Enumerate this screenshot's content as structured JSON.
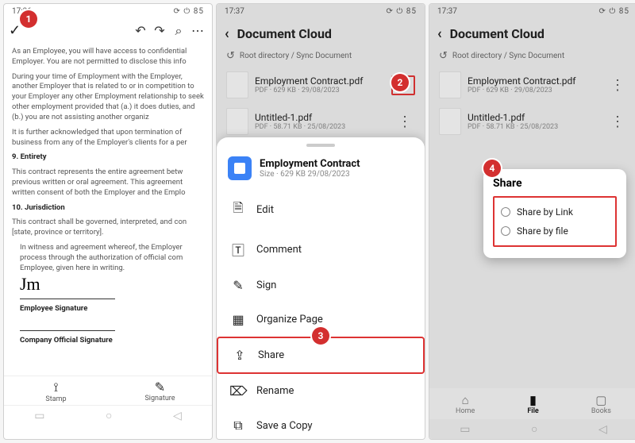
{
  "status": {
    "time_p1": "17:36",
    "time_p2": "17:37",
    "time_p3": "17:37",
    "battery": "85"
  },
  "markers": {
    "m1": "1",
    "m2": "2",
    "m3": "3",
    "m4": "4"
  },
  "p1": {
    "body": {
      "l1": "As an Employee, you will have access to confidential",
      "l2": "Employer. You are not permitted to disclose this info",
      "p2": "During your time of Employment with the Employer, another Employer that is related to or in competition to your Employer any other Employment relationship to seek other employment provided that (a.) it does duties, and (b.) you are not assisting another organiz",
      "p3": "It is further acknowledged that upon termination of business from any of the Employer's clients for a per",
      "h9": "9.   Entirety",
      "p4": "This contract represents the entire agreement betw previous written or oral agreement. This agreement written consent of both the Employer and the Emplo",
      "h10": "10. Jurisdiction",
      "p5": "This contract shall be governed, interpreted, and con [state, province or territory].",
      "p6": "In witness and agreement whereof, the Employer process through the authorization of official com Employee, given here in writing.",
      "sig1": "Employee Signature",
      "sig2": "Company Official Signature"
    },
    "bottom": {
      "stamp": "Stamp",
      "signature": "Signature"
    }
  },
  "cloud": {
    "title": "Document Cloud",
    "breadcrumb": "Root directory / Sync Document",
    "files": [
      {
        "name": "Employment Contract.pdf",
        "info": "PDF · 629 KB · 29/08/2023"
      },
      {
        "name": "Untitled-1.pdf",
        "info": "PDF · 58.71 KB · 25/08/2023"
      }
    ]
  },
  "sheet": {
    "docname": "Employment Contract",
    "docsize": "Size · 629 KB 29/08/2023",
    "items": {
      "edit": "Edit",
      "comment": "Comment",
      "sign": "Sign",
      "organize": "Organize Page",
      "share": "Share",
      "rename": "Rename",
      "savecopy": "Save a Copy"
    }
  },
  "popover": {
    "title": "Share",
    "opt1": "Share by Link",
    "opt2": "Share by file"
  },
  "tabs": {
    "home": "Home",
    "file": "File",
    "books": "Books"
  }
}
